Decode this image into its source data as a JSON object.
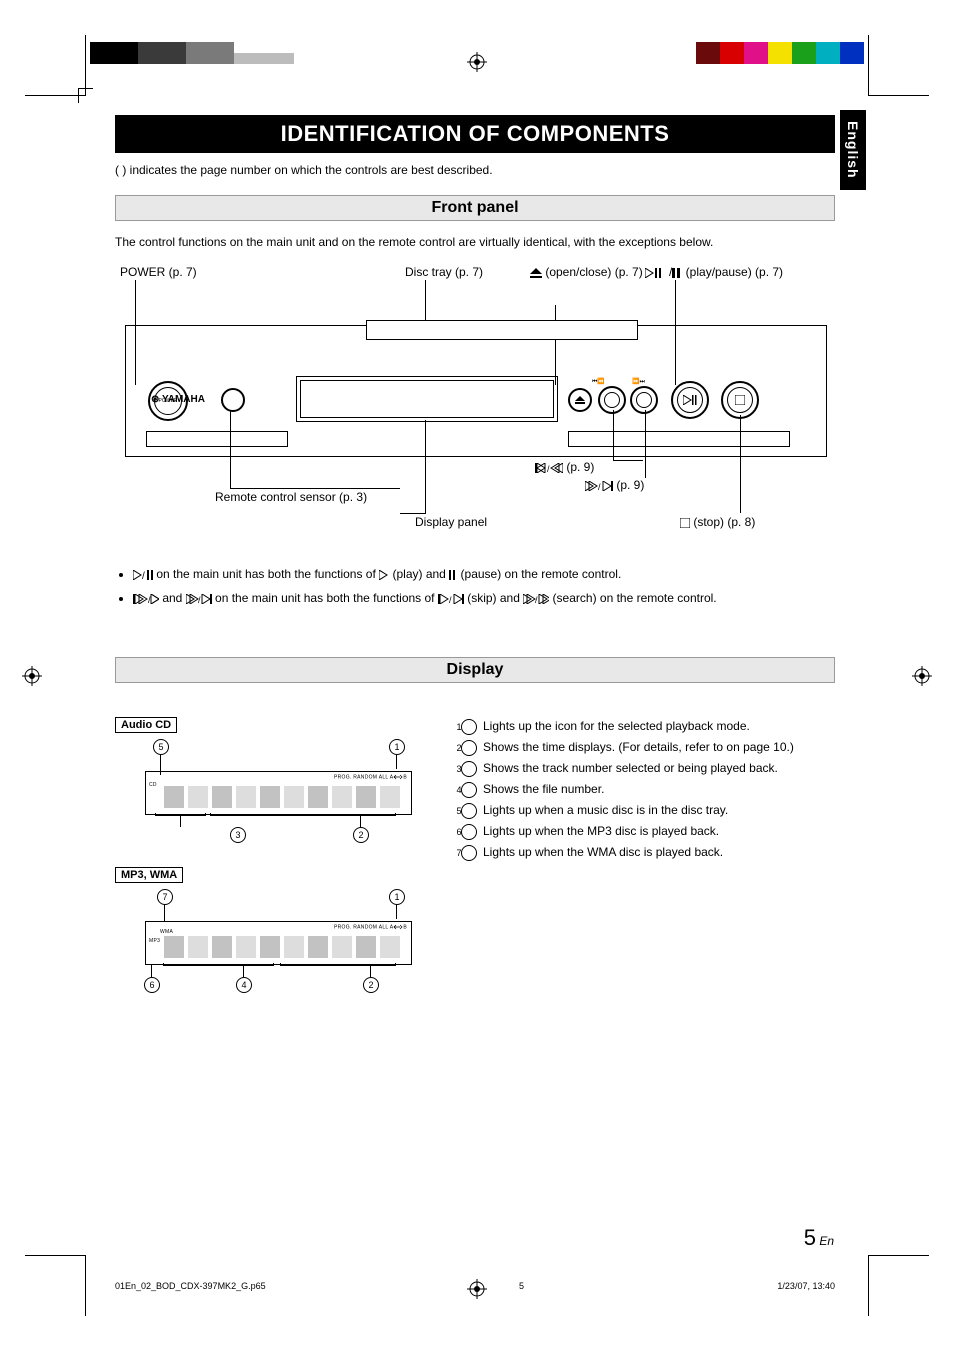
{
  "header": {
    "title": "IDENTIFICATION OF COMPONENTS",
    "lang_tab": "English",
    "page_indicator_note": "(    ) indicates the page number on which the controls are best described."
  },
  "front_panel": {
    "section_title": "Front panel",
    "intro": "The control functions on the main unit and on the remote control are virtually identical, with the exceptions below.",
    "labels": {
      "power": "POWER (p. 7)",
      "disc_tray": "Disc tray (p. 7)",
      "play_pause": " (play/pause) (p. 7)",
      "open_close": " (open/close) (p. 7)",
      "prev_search": " (p. 9)",
      "next_search": " (p. 9)",
      "remote_sensor": "Remote control sensor (p. 3)",
      "display_panel": "Display panel",
      "stop": " (stop) (p. 8)"
    },
    "brand": "YAMAHA",
    "bullets": {
      "b1_pre": " on the main unit has both the functions of ",
      "b1_mid": " (play) and ",
      "b1_post": " (pause) on the remote control.",
      "b2_pre": " and ",
      "b2_mid": " on the main unit has both the functions of ",
      "b2_mid2": " (skip) and ",
      "b2_post": " (search) on the remote control."
    }
  },
  "display": {
    "section_title": "Display",
    "audio_cd_label": "Audio CD",
    "mp3_wma_label": "MP3, WMA",
    "cd_tag": "CD",
    "mp3_tag": "MP3",
    "wma_tag": "WMA",
    "modes_text": "PROG.  RANDOM  ALL  A",
    "modes_suffix": "B",
    "list": {
      "i1": "Lights up the icon for the selected playback mode.",
      "i2": "Shows the time displays. (For details, refer to on page 10.)",
      "i3": "Shows the track number selected or being played back.",
      "i4": "Shows the file number.",
      "i5": "Lights up when a music disc is in the disc tray.",
      "i6": "Lights up when the MP3 disc is played back.",
      "i7": "Lights up when the WMA disc is played back."
    }
  },
  "footer": {
    "filename": "01En_02_BOD_CDX-397MK2_G.p65",
    "page": "5",
    "datetime": "1/23/07, 13:40"
  },
  "page_number": {
    "num": "5",
    "suffix": "En"
  }
}
